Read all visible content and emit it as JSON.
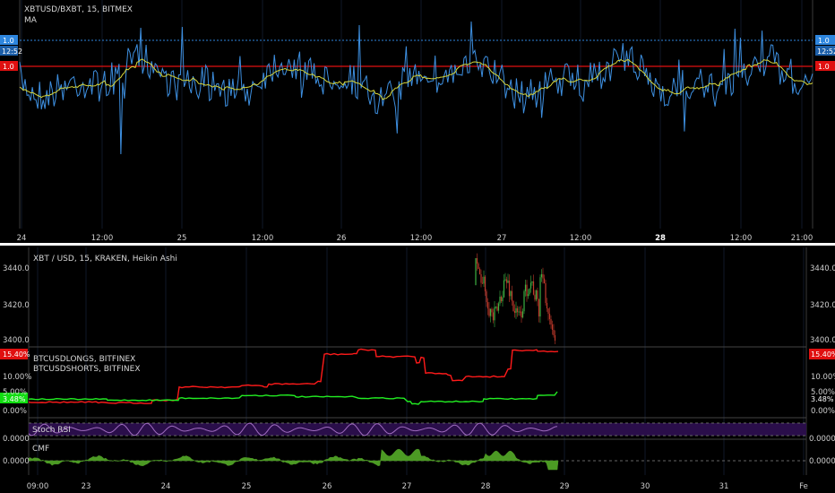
{
  "colors": {
    "background": "#000000",
    "grid": "#1a2a44",
    "price_line": "#3d8fe0",
    "ma_line": "#d6d63a",
    "red_level": "#e01010",
    "blue_level": "#2e86de",
    "longs": "#ff1a1a",
    "shorts": "#22ee22",
    "rsi": "#a06cc0",
    "rsi_band": "#2a0e4a",
    "cmf": "#4c9a24",
    "candle_up": "#3cb043",
    "candle_down": "#c0392b",
    "separator": "#ffffff"
  },
  "chart_data": [
    {
      "id": "top",
      "type": "line",
      "title": "XBTUSD/BXBT, 15, BITMEX",
      "legend": [
        "MA"
      ],
      "x_ticks": [
        "24",
        "12:00",
        "25",
        "12:00",
        "26",
        "12:00",
        "27",
        "12:00",
        "28",
        "12:00",
        "21:00"
      ],
      "bold_ticks": [
        "28"
      ],
      "level_labels": [
        "1.0",
        "1.0"
      ],
      "price_badge": "12:52",
      "series": [
        {
          "name": "XBTUSD/BXBT",
          "color_key": "price_line"
        },
        {
          "name": "MA",
          "color_key": "ma_line"
        }
      ]
    },
    {
      "id": "price",
      "type": "candlestick",
      "title": "XBT / USD, 15, KRAKEN, Heikin Ashi",
      "y_ticks": [
        "3440.0",
        "3420.0",
        "3400.0"
      ],
      "ylim": [
        3396,
        3450
      ]
    },
    {
      "id": "longs-shorts",
      "type": "line",
      "series_labels": [
        "BTCUSDLONGS, BITFINEX",
        "BTCUSDSHORTS, BITFINEX"
      ],
      "y_ticks": [
        "10.00%",
        "5.00%",
        "0.00%"
      ],
      "longs_badge": "15.40%",
      "shorts_badge": "3.48%",
      "ylim": [
        -1,
        16.5
      ]
    },
    {
      "id": "stoch-rsi",
      "type": "line",
      "label": "Stoch RSI",
      "y_ticks": [
        "0.0000"
      ]
    },
    {
      "id": "cmf",
      "type": "area",
      "label": "CMF",
      "y_ticks": [
        "0.0000"
      ]
    }
  ],
  "x_axis_bottom": [
    "09:00",
    "23",
    "24",
    "25",
    "26",
    "27",
    "28",
    "29",
    "30",
    "31",
    "Fe"
  ]
}
